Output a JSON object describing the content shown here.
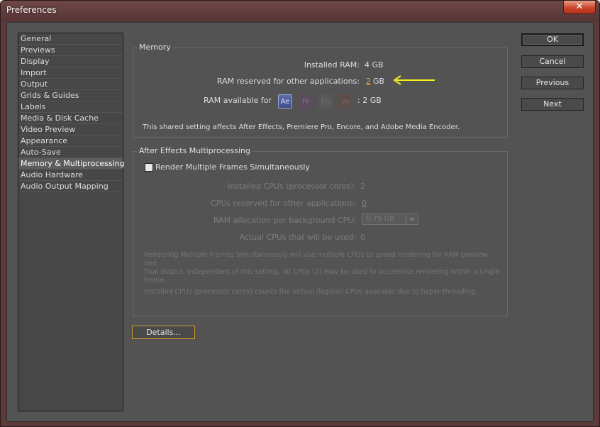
{
  "window": {
    "title": "Preferences",
    "close_label": "✕"
  },
  "sidebar": {
    "items": [
      {
        "label": "General",
        "selected": false
      },
      {
        "label": "Previews",
        "selected": false
      },
      {
        "label": "Display",
        "selected": false
      },
      {
        "label": "Import",
        "selected": false
      },
      {
        "label": "Output",
        "selected": false
      },
      {
        "label": "Grids & Guides",
        "selected": false
      },
      {
        "label": "Labels",
        "selected": false
      },
      {
        "label": "Media & Disk Cache",
        "selected": false
      },
      {
        "label": "Video Preview",
        "selected": false
      },
      {
        "label": "Appearance",
        "selected": false
      },
      {
        "label": "Auto-Save",
        "selected": false
      },
      {
        "label": "Memory & Multiprocessing",
        "selected": true
      },
      {
        "label": "Audio Hardware",
        "selected": false
      },
      {
        "label": "Audio Output Mapping",
        "selected": false
      }
    ]
  },
  "memory": {
    "title": "Memory",
    "installed_ram_label": "Installed RAM:",
    "installed_ram_value": "4 GB",
    "reserved_label": "RAM reserved for other applications:",
    "reserved_value": "2",
    "reserved_unit": "GB",
    "available_label": "RAM available for",
    "apps": [
      {
        "label": "Ae",
        "icon": "after-effects-icon",
        "active": true
      },
      {
        "label": "Pr",
        "icon": "premiere-pro-icon",
        "active": false
      },
      {
        "label": "En",
        "icon": "encore-icon",
        "active": false
      },
      {
        "label": "Me",
        "icon": "media-encoder-icon",
        "active": false
      }
    ],
    "available_value": ": 2 GB",
    "shared_note": "This shared setting affects After Effects, Premiere Pro, Encore, and Adobe Media Encoder."
  },
  "mp": {
    "title": "After Effects Multiprocessing",
    "render_checkbox_label": "Render Multiple Frames Simultaneously",
    "render_checked": false,
    "installed_cpus_label": "Installed CPUs (processor cores):",
    "installed_cpus_value": "2",
    "cpus_reserved_label": "CPUs reserved for other applications:",
    "cpus_reserved_value": "0",
    "ram_per_cpu_label": "RAM allocation per background CPU:",
    "ram_per_cpu_value": "0,75 GB",
    "actual_cpus_label": "Actual CPUs that will be used:",
    "actual_cpus_value": "0",
    "note1_line1": "Rendering Multiple Frames Simultaneously will use multiple CPUs to speed rendering for RAM preview and",
    "note1_line2": "final output. Independent of this setting, all CPUs (2) may be used to accelerate rendering within a single",
    "note1_line3": "frame.",
    "note2": "Installed CPUs (processor cores) counts the virtual (logical) CPUs available due to hyper-threading."
  },
  "buttons": {
    "details": "Details...",
    "ok": "OK",
    "cancel": "Cancel",
    "previous": "Previous",
    "next": "Next"
  },
  "annotation": {
    "icon": "arrow-left-icon",
    "color": "#f5f01e"
  }
}
